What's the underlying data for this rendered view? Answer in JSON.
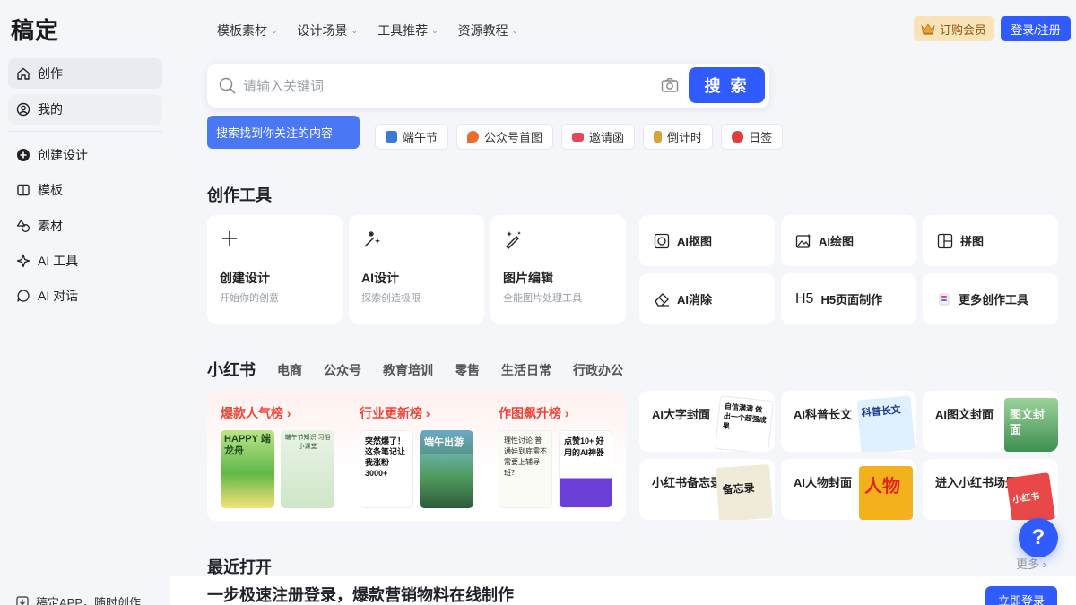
{
  "sidebar": {
    "logo": "稿定",
    "items": [
      {
        "label": "创作",
        "icon": "home-icon"
      },
      {
        "label": "我的",
        "icon": "user-icon"
      },
      {
        "label": "创建设计",
        "icon": "plus-circle-icon"
      },
      {
        "label": "模板",
        "icon": "template-icon"
      },
      {
        "label": "素材",
        "icon": "shapes-icon"
      },
      {
        "label": "AI 工具",
        "icon": "sparkle-icon"
      },
      {
        "label": "AI 对话",
        "icon": "chat-icon"
      }
    ],
    "footer": "稿定APP，随时创作"
  },
  "topnav": {
    "items": [
      "模板素材",
      "设计场景",
      "工具推荐",
      "资源教程"
    ],
    "vip_label": "订购会员",
    "login_label": "登录/注册"
  },
  "search": {
    "placeholder": "请输入关键词",
    "button_label": "搜 索",
    "tooltip": "搜索找到你关注的内容"
  },
  "chips": [
    {
      "label": "端午节",
      "color": "#3a7bd5"
    },
    {
      "label": "公众号首图",
      "color": "#f06a2a"
    },
    {
      "label": "邀请函",
      "color": "#e8465a"
    },
    {
      "label": "倒计时",
      "color": "#d9a23a"
    },
    {
      "label": "日签",
      "color": "#e03c3c"
    }
  ],
  "tools": {
    "title": "创作工具",
    "cards": [
      {
        "name": "创建设计",
        "desc": "开始你的创意",
        "icon": "plus-icon"
      },
      {
        "name": "AI设计",
        "desc": "探索创造极限",
        "icon": "magic-wand-icon"
      },
      {
        "name": "图片编辑",
        "desc": "全能图片处理工具",
        "icon": "image-edit-icon"
      }
    ],
    "mini": [
      {
        "name": "AI抠图",
        "icon": "cutout-icon"
      },
      {
        "name": "AI绘图",
        "icon": "ai-draw-icon"
      },
      {
        "name": "拼图",
        "icon": "collage-icon"
      },
      {
        "name": "AI消除",
        "icon": "eraser-icon"
      },
      {
        "name": "H5页面制作",
        "icon": "h5-icon",
        "icon_text": "H5"
      },
      {
        "name": "更多创作工具",
        "icon": "more-tools-icon"
      }
    ]
  },
  "xhs": {
    "title": "小红书",
    "tabs": [
      "电商",
      "公众号",
      "教育培训",
      "零售",
      "生活日常",
      "行政办公"
    ],
    "ranks": [
      {
        "title": "爆款人气榜 ›"
      },
      {
        "title": "行业更新榜 ›"
      },
      {
        "title": "作图飙升榜 ›"
      }
    ],
    "thumbs": {
      "t1": "HAPPY 端龙舟",
      "t2": "端午节知识 习俗小课堂",
      "t3": "突然爆了！这条笔记让我涨粉3000+",
      "t4": "端午出游",
      "t5": "理性讨论 普通娃到底需不需要上辅导班？",
      "t6": "点赞10+ 好用的AI神器"
    },
    "cards": [
      {
        "name": "AI大字封面",
        "art": "自信满满 做出一个超强成果"
      },
      {
        "name": "AI科普长文",
        "art": "科普长文"
      },
      {
        "name": "AI图文封面",
        "art": "图文封面"
      },
      {
        "name": "小红书备忘录",
        "art": "备忘录"
      },
      {
        "name": "AI人物封面",
        "art": "人物"
      },
      {
        "name": "进入小红书场景 ›",
        "art": "小红书"
      }
    ]
  },
  "recent": {
    "title": "最近打开",
    "more": "更多 ›"
  },
  "banner": {
    "text": "一步极速注册登录，爆款营销物料在线制作",
    "button": "立即登录"
  },
  "help": "?",
  "colors": {
    "primary": "#2f5bff",
    "rank_red": "#f0453a",
    "vip_bg": "#fbe3b9"
  }
}
